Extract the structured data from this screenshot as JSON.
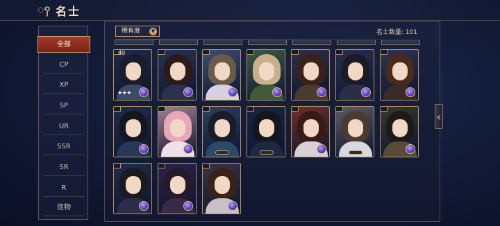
{
  "header": {
    "swirl_icon": "cloud-swirl-icon",
    "title": "名士"
  },
  "sidebar": {
    "items": [
      {
        "label": "全部",
        "active": true
      },
      {
        "label": "CP"
      },
      {
        "label": "XP"
      },
      {
        "label": "SP"
      },
      {
        "label": "UR"
      },
      {
        "label": "SSR"
      },
      {
        "label": "SR"
      },
      {
        "label": "R"
      },
      {
        "label": "信物"
      }
    ]
  },
  "filter": {
    "label": "稀有度",
    "icon": "chevron-down-icon"
  },
  "count": "名士数量: 101",
  "cards": [
    {
      "level": "60",
      "stars": "✦✦✦",
      "orb": true,
      "hair": "#1a1c2c",
      "robe": "#3a4a6a",
      "bg": "#1e2a48"
    },
    {
      "orb": true,
      "hair": "#2a1a18",
      "robe": "#2e3050",
      "bg": "#243452"
    },
    {
      "orb": true,
      "hair": "#6a5a48",
      "robe": "#d8d0e0",
      "bg": "#3a5070"
    },
    {
      "orb": true,
      "hair": "#c8b08a",
      "robe": "#405a3a",
      "bg": "#3a5a4a"
    },
    {
      "orb": true,
      "hair": "#3a2218",
      "robe": "#4a3a30",
      "bg": "#2a3048"
    },
    {
      "orb": true,
      "hair": "#1c1a24",
      "robe": "#2a2e48",
      "bg": "#243050"
    },
    {
      "orb": true,
      "hair": "#4a2a1a",
      "robe": "#3a2a28",
      "bg": "#2e3450"
    },
    {
      "orb": true,
      "hair": "#141620",
      "robe": "#283858",
      "bg": "#1e2c4a"
    },
    {
      "orb": true,
      "hair": "#e8a8b8",
      "robe": "#f0e0e8",
      "bg": "#a08090"
    },
    {
      "pill": true,
      "hair": "#1a1c28",
      "robe": "#2a4a68",
      "bg": "#2a4060"
    },
    {
      "pill": true,
      "hair": "#14161e",
      "robe": "#1e2840",
      "bg": "#1a2440"
    },
    {
      "orb": true,
      "hair": "#3a1a14",
      "robe": "#d8d0d8",
      "bg": "#6a3028"
    },
    {
      "pill": true,
      "hair": "#4a3a30",
      "robe": "#d8d8e0",
      "bg": "#5a5a68"
    },
    {
      "orb": true,
      "hair": "#1e1a18",
      "robe": "#5a4a38",
      "bg": "#34382e"
    },
    {
      "orb": true,
      "hair": "#1a1a22",
      "robe": "#2a2e4a",
      "bg": "#222a44"
    },
    {
      "orb": true,
      "hair": "#241a2c",
      "robe": "#3a2a4a",
      "bg": "#2a2444"
    },
    {
      "orb": true,
      "hair": "#3a2218",
      "robe": "#c8c0c8",
      "bg": "#3a3440"
    }
  ]
}
